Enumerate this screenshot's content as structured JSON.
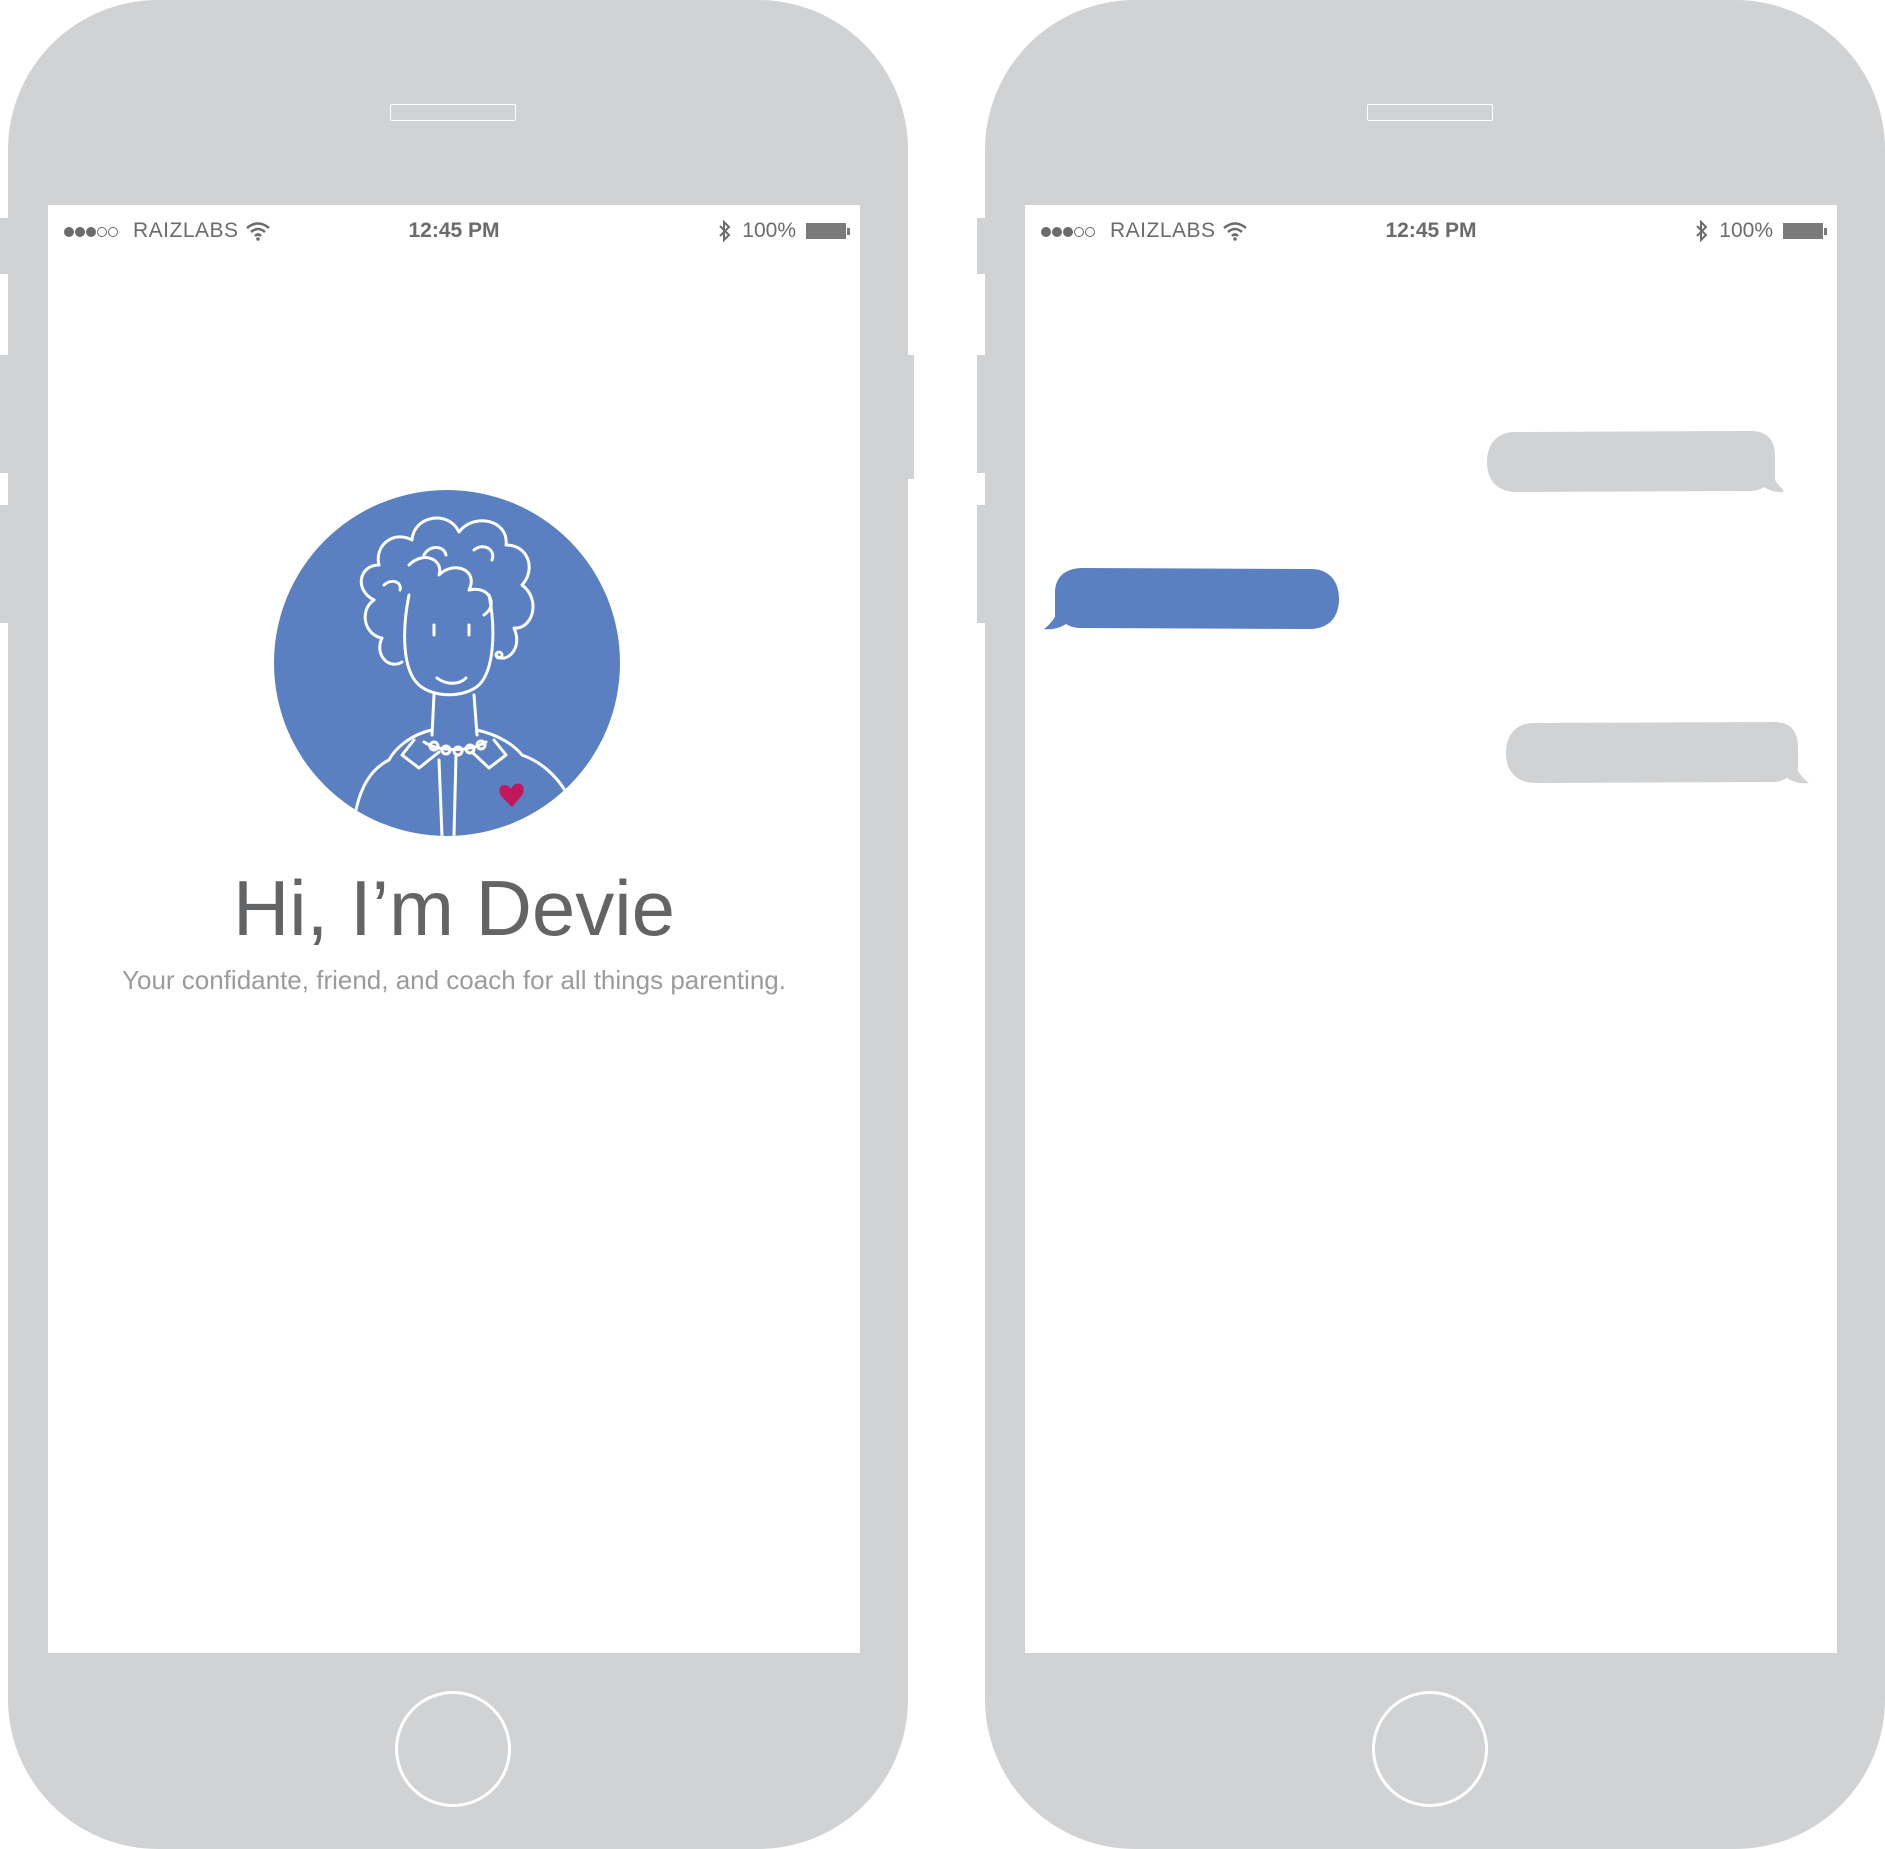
{
  "phones": [
    {
      "status_bar": {
        "signal_dots": "●●●○○",
        "carrier": "RAIZLABS",
        "time": "12:45 PM",
        "battery_percent": "100%"
      },
      "welcome": {
        "title": "Hi, I’m Devie",
        "subtitle": "Your confidante, friend, and coach for all things parenting."
      },
      "avatar": {
        "icon": "devie-avatar-icon",
        "background": "#5a80c1"
      }
    },
    {
      "status_bar": {
        "signal_dots": "●●●○○",
        "carrier": "RAIZLABS",
        "time": "12:45 PM",
        "battery_percent": "100%"
      },
      "chat": {
        "messages": [
          {
            "side": "right",
            "color": "#d1d2d4"
          },
          {
            "side": "left",
            "color": "#5a80c1"
          },
          {
            "side": "right",
            "color": "#d1d2d4"
          }
        ]
      }
    }
  ],
  "colors": {
    "phone_frame": "#d1d2d4",
    "accent_blue": "#5a80c1",
    "text_dark": "#636466",
    "text_light": "#9b9b9b"
  }
}
